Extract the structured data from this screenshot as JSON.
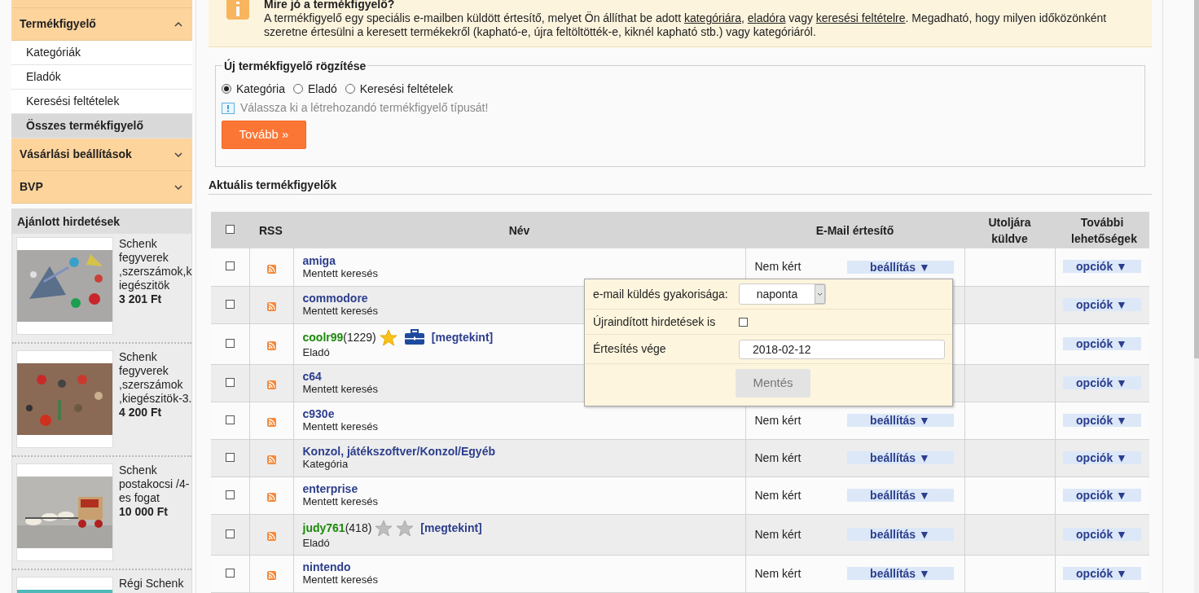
{
  "sidebar": {
    "sections": [
      {
        "title": "Termékfigyelő",
        "expanded": true,
        "items": [
          {
            "label": "Kategóriák",
            "selected": false
          },
          {
            "label": "Eladók",
            "selected": false
          },
          {
            "label": "Keresési feltételek",
            "selected": false
          },
          {
            "label": "Összes termékfigyelő",
            "selected": true
          }
        ]
      },
      {
        "title": "Vásárlási beállítások",
        "expanded": false
      },
      {
        "title": "BVP",
        "expanded": false
      }
    ],
    "ads": {
      "title": "Ajánlott hirdetések",
      "items": [
        {
          "title": "Schenk fegyverek ,szerszámok,kiegészitök",
          "price": "3 201 Ft"
        },
        {
          "title": "Schenk fegyverek ,szerszámok ,kiegészitök-3.",
          "price": "4 200 Ft"
        },
        {
          "title": "Schenk postakocsi /4-es fogat",
          "price": "10 000 Ft"
        },
        {
          "title": "Régi Schenk"
        }
      ]
    }
  },
  "info": {
    "title": "Mire jó a termékfigyelő?",
    "text": [
      {
        "kind": "text",
        "text": "A termékfigyelő egy speciális e-mailben küldött értesítő, melyet Ön állíthat be adott "
      },
      {
        "kind": "link",
        "text": "kategóriára"
      },
      {
        "kind": "text",
        "text": ", "
      },
      {
        "kind": "link",
        "text": "eladóra"
      },
      {
        "kind": "text",
        "text": " vagy "
      },
      {
        "kind": "link",
        "text": "keresési feltételre"
      },
      {
        "kind": "text",
        "text": ". Megadható, hogy milyen időközönként szeretne értesülni a keresett termékekről (kapható-e, újra feltöltötték-e, kiknél kapható stb.) vagy kategóriáról."
      }
    ]
  },
  "new_watcher": {
    "legend": "Új termékfigyelő rögzítése",
    "options": [
      {
        "label": "Kategória",
        "selected": true
      },
      {
        "label": "Eladó",
        "selected": false
      },
      {
        "label": "Keresési feltételek",
        "selected": false
      }
    ],
    "hint": "Válassza ki a létrehozandó termékfigyelő típusát!",
    "button": "Tovább »"
  },
  "current": {
    "title": "Aktuális termékfigyelők",
    "table": {
      "select_all_checked": false,
      "columns": [
        "RSS",
        "Név",
        "E-Mail értesítő",
        "Utoljára küldve",
        "További lehetőségek"
      ],
      "rows": [
        {
          "checked": false,
          "kind": "search",
          "name": "amiga",
          "type": "Mentett keresés",
          "email": {
            "status": "Nem kért",
            "button": "beállítás ▼"
          },
          "options": "opciók ▼"
        },
        {
          "checked": false,
          "kind": "search",
          "name": "commodore",
          "type": "Mentett keresés",
          "options": "opciók ▼"
        },
        {
          "checked": false,
          "kind": "seller",
          "name": "coolr99",
          "count": "(1229)",
          "badges": [
            {
              "kind": "star-gold"
            },
            {
              "kind": "briefcase"
            }
          ],
          "view": "[megtekint]",
          "type": "Eladó",
          "options": "opciók ▼"
        },
        {
          "checked": false,
          "kind": "search",
          "name": "c64",
          "type": "Mentett keresés",
          "options": "opciók ▼"
        },
        {
          "checked": false,
          "kind": "search",
          "name": "c930e",
          "type": "Mentett keresés",
          "email": {
            "status": "Nem kért",
            "button": "beállítás ▼"
          },
          "options": "opciók ▼"
        },
        {
          "checked": false,
          "kind": "category",
          "name": "Konzol, játékszoftver/Konzol/Egyéb",
          "type": "Kategória",
          "email": {
            "status": "Nem kért",
            "button": "beállítás ▼"
          },
          "options": "opciók ▼"
        },
        {
          "checked": false,
          "kind": "search",
          "name": "enterprise",
          "type": "Mentett keresés",
          "email": {
            "status": "Nem kért",
            "button": "beállítás ▼"
          },
          "options": "opciók ▼"
        },
        {
          "checked": false,
          "kind": "seller",
          "name": "judy761",
          "count": "(418)",
          "badges": [
            {
              "kind": "star-grey"
            },
            {
              "kind": "star-grey"
            }
          ],
          "view": "[megtekint]",
          "type": "Eladó",
          "email": {
            "status": "Nem kért",
            "button": "beállítás ▼"
          },
          "options": "opciók ▼"
        },
        {
          "checked": false,
          "kind": "search",
          "name": "nintendo",
          "type": "Mentett keresés",
          "email": {
            "status": "Nem kért",
            "button": "beállítás ▼"
          },
          "options": "opciók ▼"
        }
      ]
    },
    "popup": {
      "frequency_label": "e-mail küldés gyakorisága:",
      "frequency": "naponta",
      "relisted_label": "Újraindított hirdetések is",
      "relisted_checked": false,
      "end_label": "Értesítés vége",
      "end_date": "2018-02-12",
      "save": "Mentés",
      "save_disabled": true
    }
  }
}
